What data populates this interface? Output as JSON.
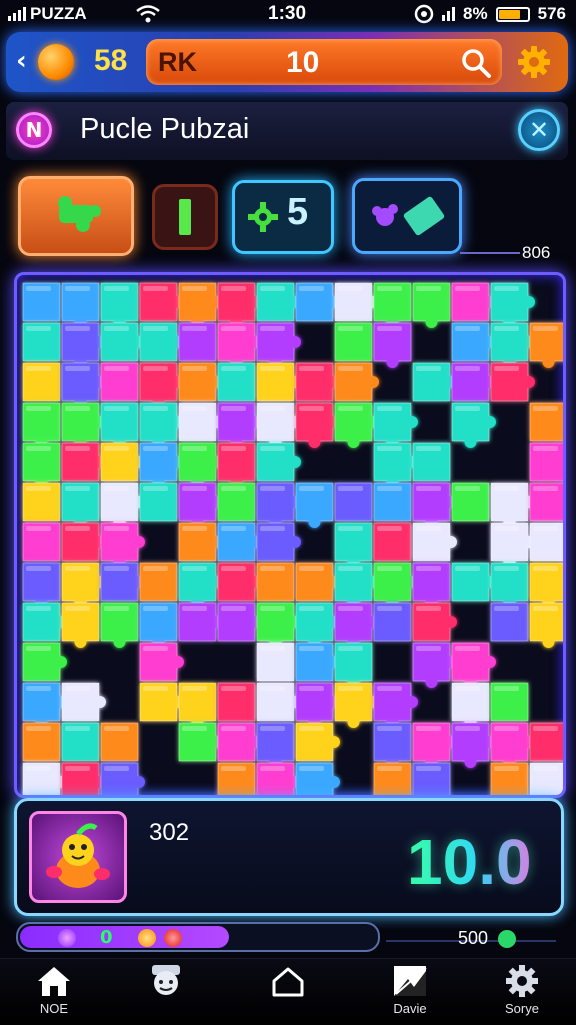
{
  "status": {
    "carrier": "PUZZA",
    "time": "1:30",
    "battery_text": "8%",
    "right_text": "576",
    "battery_level": 0.75
  },
  "topbar": {
    "coins": "58",
    "left_code": "RK",
    "value": "10"
  },
  "title": {
    "badge": "N",
    "text": "Pucle Pubzai"
  },
  "tools": {
    "count": "5",
    "side_count": "806"
  },
  "board": {
    "colors": [
      "#ff2d6a",
      "#ff8a1c",
      "#ffd21e",
      "#3cf04a",
      "#20e0c8",
      "#3aa8ff",
      "#6a5cff",
      "#b33cff",
      "#ff3cd0",
      "#e8e8ff"
    ]
  },
  "panel": {
    "label": "302",
    "score": "10.0"
  },
  "progress": {
    "level": 0.58,
    "value": "0",
    "right_count": "500"
  },
  "nav": [
    {
      "label": "NOE",
      "icon": "home-icon"
    },
    {
      "label": "",
      "icon": "character-icon"
    },
    {
      "label": "",
      "icon": "house-outline-icon"
    },
    {
      "label": "Davie",
      "icon": "image-icon"
    },
    {
      "label": "Sorye",
      "icon": "gear-icon"
    }
  ],
  "colors": {
    "accent": "#6f5cff",
    "coin": "#ffe04a",
    "score_start": "#30ff9a",
    "score_end": "#ff5ae8"
  }
}
